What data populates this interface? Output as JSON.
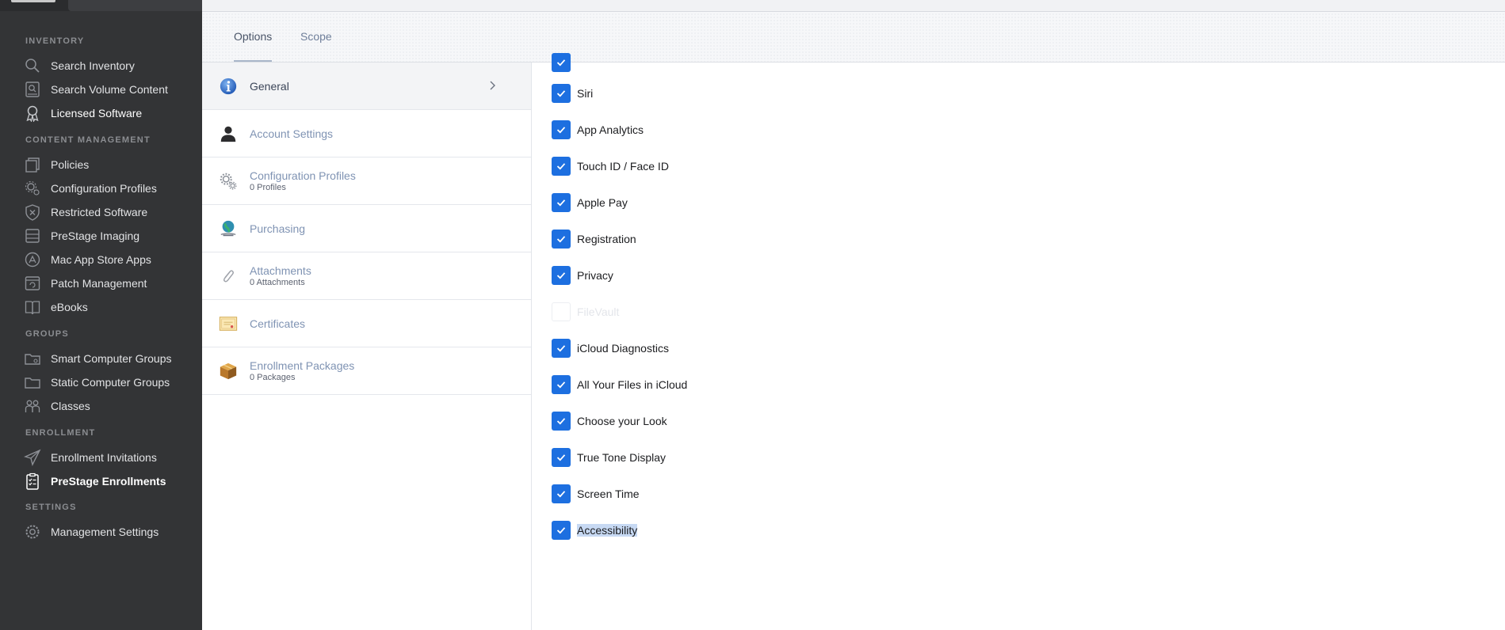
{
  "sidebar": {
    "sections": [
      {
        "title": "INVENTORY",
        "items": [
          {
            "label": "Search Inventory",
            "icon": "search-icon"
          },
          {
            "label": "Search Volume Content",
            "icon": "volume-search-icon"
          },
          {
            "label": "Licensed Software",
            "icon": "license-ribbon-icon"
          }
        ]
      },
      {
        "title": "CONTENT MANAGEMENT",
        "items": [
          {
            "label": "Policies",
            "icon": "policies-icon"
          },
          {
            "label": "Configuration Profiles",
            "icon": "gears-icon"
          },
          {
            "label": "Restricted Software",
            "icon": "shield-x-icon"
          },
          {
            "label": "PreStage Imaging",
            "icon": "drive-stack-icon"
          },
          {
            "label": "Mac App Store Apps",
            "icon": "app-store-icon"
          },
          {
            "label": "Patch Management",
            "icon": "patch-icon"
          },
          {
            "label": "eBooks",
            "icon": "book-icon"
          }
        ]
      },
      {
        "title": "GROUPS",
        "items": [
          {
            "label": "Smart Computer Groups",
            "icon": "smart-folder-icon"
          },
          {
            "label": "Static Computer Groups",
            "icon": "folder-icon"
          },
          {
            "label": "Classes",
            "icon": "people-icon"
          }
        ]
      },
      {
        "title": "ENROLLMENT",
        "items": [
          {
            "label": "Enrollment Invitations",
            "icon": "paper-plane-icon"
          },
          {
            "label": "PreStage Enrollments",
            "icon": "checklist-icon"
          }
        ]
      },
      {
        "title": "SETTINGS",
        "items": [
          {
            "label": "Management Settings",
            "icon": "gear-icon"
          }
        ]
      }
    ]
  },
  "tabs": [
    {
      "label": "Options",
      "active": true
    },
    {
      "label": "Scope",
      "active": false
    }
  ],
  "payloads": [
    {
      "title": "General",
      "subtitle": "",
      "icon": "info-icon",
      "selected": true
    },
    {
      "title": "Account Settings",
      "subtitle": "",
      "icon": "user-icon",
      "selected": false
    },
    {
      "title": "Configuration Profiles",
      "subtitle": "0 Profiles",
      "icon": "gears-icon",
      "selected": false
    },
    {
      "title": "Purchasing",
      "subtitle": "",
      "icon": "globe-icon",
      "selected": false
    },
    {
      "title": "Attachments",
      "subtitle": "0 Attachments",
      "icon": "paperclip-icon",
      "selected": false
    },
    {
      "title": "Certificates",
      "subtitle": "",
      "icon": "certificate-icon",
      "selected": false
    },
    {
      "title": "Enrollment Packages",
      "subtitle": "0 Packages",
      "icon": "package-icon",
      "selected": false
    }
  ],
  "options": [
    {
      "label": "Siri",
      "checked": true
    },
    {
      "label": "App Analytics",
      "checked": true
    },
    {
      "label": "Touch ID / Face ID",
      "checked": true
    },
    {
      "label": "Apple Pay",
      "checked": true
    },
    {
      "label": "Registration",
      "checked": true
    },
    {
      "label": "Privacy",
      "checked": true
    },
    {
      "label": "FileVault",
      "checked": false,
      "disabled": true
    },
    {
      "label": "iCloud Diagnostics",
      "checked": true
    },
    {
      "label": "All Your Files in iCloud",
      "checked": true
    },
    {
      "label": "Choose your Look",
      "checked": true
    },
    {
      "label": "True Tone Display",
      "checked": true
    },
    {
      "label": "Screen Time",
      "checked": true
    },
    {
      "label": "Accessibility",
      "checked": true,
      "text_selected": true
    }
  ],
  "colors": {
    "sidebar_bg": "#333436",
    "checkbox_blue": "#1d6fe0",
    "selection_highlight": "#c7d9f3",
    "payload_title": "#7f93b3"
  }
}
